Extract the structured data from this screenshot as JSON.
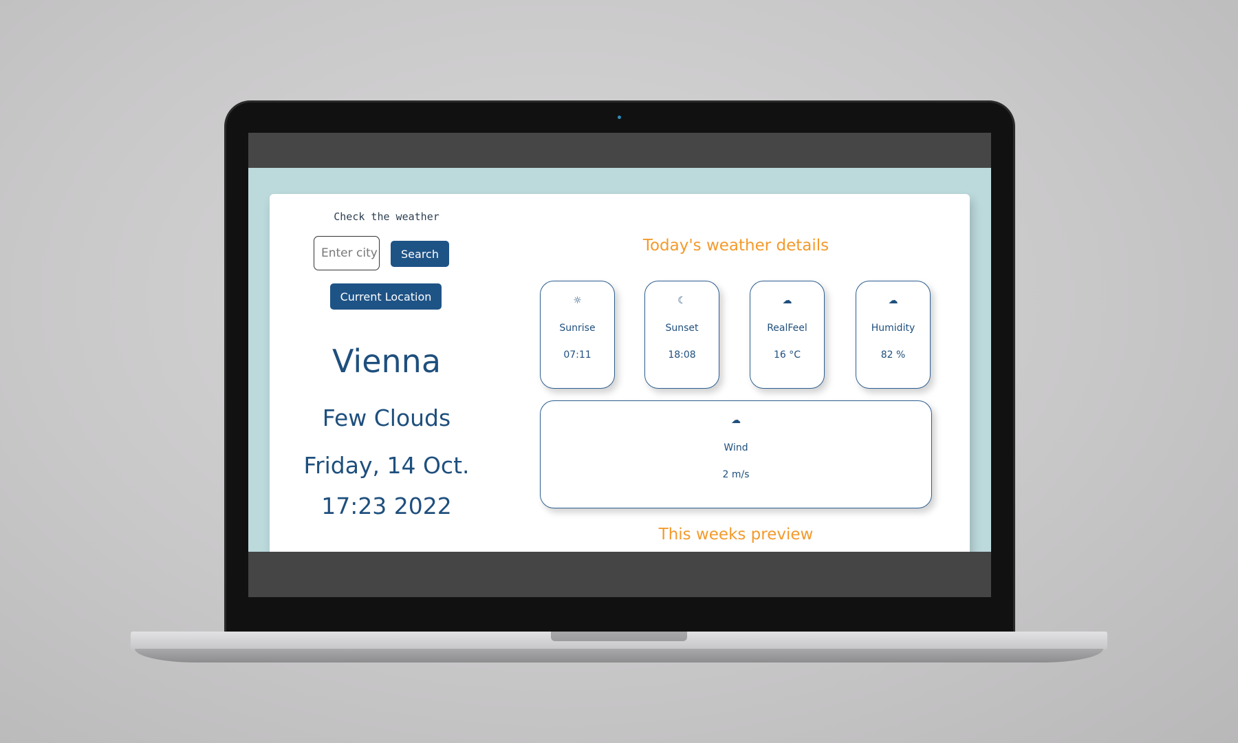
{
  "app": {
    "heading": "Check the weather",
    "search_placeholder": "Enter city",
    "search_button": "Search",
    "location_button": "Current Location"
  },
  "current": {
    "city": "Vienna",
    "condition": "Few Clouds",
    "date": "Friday, 14 Oct.",
    "time_year": "17:23 2022"
  },
  "details": {
    "title": "Today's weather details",
    "tiles": [
      {
        "icon": "sun-icon",
        "glyph": "☼",
        "label": "Sunrise",
        "value": "07:11"
      },
      {
        "icon": "moon-cloud-icon",
        "glyph": "☾",
        "label": "Sunset",
        "value": "18:08"
      },
      {
        "icon": "cloud-rain-icon",
        "glyph": "☁",
        "label": "RealFeel",
        "value": "16 °C"
      },
      {
        "icon": "cloud-sun-icon",
        "glyph": "☁",
        "label": "Humidity",
        "value": "82 %"
      }
    ],
    "wind": {
      "icon": "cloud-sun-icon",
      "glyph": "☁",
      "label": "Wind",
      "value": "2 m/s"
    }
  },
  "week": {
    "title": "This weeks preview"
  },
  "colors": {
    "primary": "#1e5386",
    "accent": "#f39a2b",
    "page_background": "#bcd9dc"
  }
}
